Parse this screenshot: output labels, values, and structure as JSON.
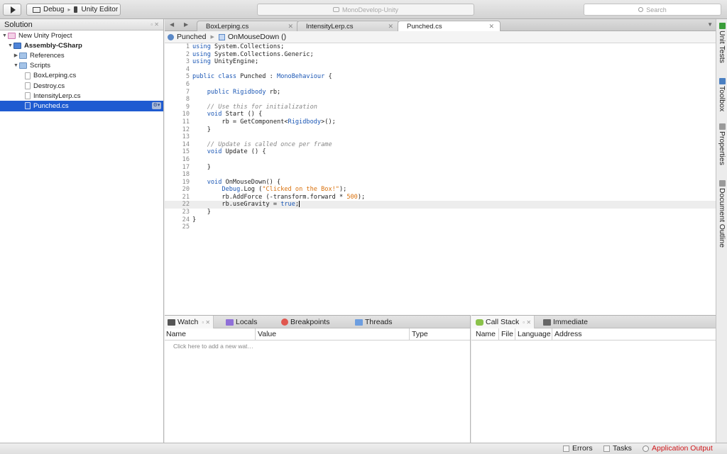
{
  "toolbar": {
    "config": "Debug",
    "target": "Unity Editor",
    "window_title": "MonoDevelop-Unity",
    "search_placeholder": "Search"
  },
  "solution": {
    "title": "Solution",
    "items": [
      {
        "label": "New Unity Project",
        "icon": "project-icon",
        "level": 0,
        "expanded": true
      },
      {
        "label": "Assembly-CSharp",
        "icon": "assembly-icon",
        "level": 1,
        "expanded": true,
        "bold": true
      },
      {
        "label": "References",
        "icon": "folder-icon",
        "level": 2,
        "expanded": false
      },
      {
        "label": "Scripts",
        "icon": "folder-icon",
        "level": 2,
        "expanded": true
      },
      {
        "label": "BoxLerping.cs",
        "icon": "file-icon",
        "level": 3
      },
      {
        "label": "Destroy.cs",
        "icon": "file-icon",
        "level": 3
      },
      {
        "label": "IntensityLerp.cs",
        "icon": "file-icon",
        "level": 3
      },
      {
        "label": "Punched.cs",
        "icon": "file-icon",
        "level": 3,
        "selected": true
      }
    ]
  },
  "editor": {
    "tabs": [
      {
        "label": "BoxLerping.cs",
        "active": false
      },
      {
        "label": "IntensityLerp.cs",
        "active": false
      },
      {
        "label": "Punched.cs",
        "active": true
      }
    ],
    "path": {
      "class": "Punched",
      "method": "OnMouseDown ()"
    },
    "current_line": 22,
    "lines": [
      [
        [
          "kw",
          "using"
        ],
        [
          "tx",
          " System.Collections;"
        ]
      ],
      [
        [
          "kw",
          "using"
        ],
        [
          "tx",
          " System.Collections.Generic;"
        ]
      ],
      [
        [
          "kw",
          "using"
        ],
        [
          "tx",
          " UnityEngine;"
        ]
      ],
      [],
      [
        [
          "kw",
          "public class"
        ],
        [
          "tx",
          " Punched : "
        ],
        [
          "ty",
          "MonoBehaviour"
        ],
        [
          "tx",
          " {"
        ]
      ],
      [],
      [
        [
          "tx",
          "    "
        ],
        [
          "kw",
          "public"
        ],
        [
          "tx",
          " "
        ],
        [
          "ty",
          "Rigidbody"
        ],
        [
          "tx",
          " rb;"
        ]
      ],
      [],
      [
        [
          "tx",
          "    "
        ],
        [
          "cm",
          "// Use this for initialization"
        ]
      ],
      [
        [
          "tx",
          "    "
        ],
        [
          "kw",
          "void"
        ],
        [
          "tx",
          " Start () {"
        ]
      ],
      [
        [
          "tx",
          "        rb = GetComponent<"
        ],
        [
          "ty",
          "Rigidbody"
        ],
        [
          "tx",
          ">();"
        ]
      ],
      [
        [
          "tx",
          "    }"
        ]
      ],
      [],
      [
        [
          "tx",
          "    "
        ],
        [
          "cm",
          "// Update is called once per frame"
        ]
      ],
      [
        [
          "tx",
          "    "
        ],
        [
          "kw",
          "void"
        ],
        [
          "tx",
          " Update () {"
        ]
      ],
      [],
      [
        [
          "tx",
          "    }"
        ]
      ],
      [],
      [
        [
          "tx",
          "    "
        ],
        [
          "kw",
          "void"
        ],
        [
          "tx",
          " OnMouseDown() {"
        ]
      ],
      [
        [
          "tx",
          "        "
        ],
        [
          "ty",
          "Debug"
        ],
        [
          "tx",
          ".Log ("
        ],
        [
          "st",
          "\"Clicked on the Box!\""
        ],
        [
          "tx",
          ");"
        ]
      ],
      [
        [
          "tx",
          "        rb.AddForce (-transform.forward * "
        ],
        [
          "nm",
          "500"
        ],
        [
          "tx",
          ");"
        ]
      ],
      [
        [
          "tx",
          "        rb.useGravity = "
        ],
        [
          "kw",
          "true"
        ],
        [
          "tx",
          ";"
        ]
      ],
      [
        [
          "tx",
          "    }"
        ]
      ],
      [
        [
          "tx",
          "}"
        ]
      ],
      []
    ]
  },
  "right_dock": [
    {
      "label": "Unit Tests",
      "icon": "unit-tests-icon",
      "color": "#3a9d3a"
    },
    {
      "label": "Toolbox",
      "icon": "toolbox-icon",
      "color": "#4a7fc1"
    },
    {
      "label": "Properties",
      "icon": "properties-icon",
      "color": "#9a9a9a"
    },
    {
      "label": "Document Outline",
      "icon": "outline-icon",
      "color": "#9a9a9a"
    }
  ],
  "watch_pad": {
    "tabs": [
      {
        "label": "Watch",
        "icon": "watch-icon",
        "color": "#555555",
        "active": true
      },
      {
        "label": "Locals",
        "icon": "locals-icon",
        "color": "#8f6fd8"
      },
      {
        "label": "Breakpoints",
        "icon": "breakpoints-icon",
        "color": "#e0574f"
      },
      {
        "label": "Threads",
        "icon": "threads-icon",
        "color": "#6d9ee0"
      }
    ],
    "columns": [
      "Name",
      "Value",
      "Type"
    ],
    "hint": "Click here to add a new wat…"
  },
  "callstack_pad": {
    "tabs": [
      {
        "label": "Call Stack",
        "icon": "callstack-icon",
        "color": "#8ac24a",
        "active": true
      },
      {
        "label": "Immediate",
        "icon": "immediate-icon",
        "color": "#666666"
      }
    ],
    "columns": [
      "Name",
      "File",
      "Language",
      "Address"
    ]
  },
  "statusbar": {
    "errors": "Errors",
    "tasks": "Tasks",
    "app_output": "Application Output",
    "app_output_color": "#d0181b"
  }
}
